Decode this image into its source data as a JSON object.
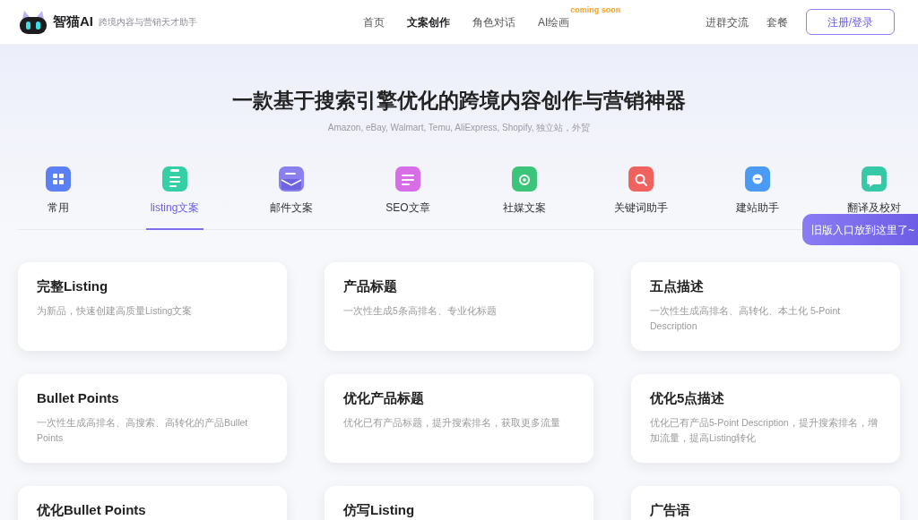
{
  "header": {
    "logo": {
      "name": "智猫AI",
      "tagline": "跨境内容与营销天才助手"
    },
    "nav": [
      {
        "label": "首页",
        "selected": false
      },
      {
        "label": "文案创作",
        "selected": true
      },
      {
        "label": "角色对话",
        "selected": false
      },
      {
        "label": "AI绘画",
        "selected": false,
        "badge": "coming soon"
      }
    ],
    "links": [
      "进群交流",
      "套餐"
    ],
    "login_button": "注册/登录"
  },
  "hero": {
    "title": "一款基于搜索引擎优化的跨境内容创作与营销神器",
    "subtitle": "Amazon, eBay, Walmart, Temu, AliExpress, Shopify, 独立站，外贸"
  },
  "tabs": [
    {
      "label": "常用",
      "selected": false,
      "color": "#5b7ff5"
    },
    {
      "label": "listing文案",
      "selected": true,
      "color": "#35cfa6"
    },
    {
      "label": "邮件文案",
      "selected": false,
      "color": "#8a80f0"
    },
    {
      "label": "SEO文章",
      "selected": false,
      "color": "#d86ee6"
    },
    {
      "label": "社媒文案",
      "selected": false,
      "color": "#3cc57a"
    },
    {
      "label": "关键词助手",
      "selected": false,
      "color": "#f0625e"
    },
    {
      "label": "建站助手",
      "selected": false,
      "color": "#4a9bf5"
    },
    {
      "label": "翻译及校对",
      "selected": false,
      "color": "#36c9a8"
    }
  ],
  "notice": "旧版入口放到这里了~",
  "cards": [
    {
      "title": "完整Listing",
      "description": "为新品，快速创建高质量Listing文案"
    },
    {
      "title": "产品标题",
      "description": "一次性生成5条高排名、专业化标题"
    },
    {
      "title": "五点描述",
      "description": "一次性生成高排名、高转化、本土化 5-Point Description"
    },
    {
      "title": "Bullet Points",
      "description": "一次性生成高排名、高搜索、高转化的产品Bullet Points"
    },
    {
      "title": "优化产品标题",
      "description": "优化已有产品标题，提升搜索排名，获取更多流量"
    },
    {
      "title": "优化5点描述",
      "description": "优化已有产品5-Point Description，提升搜索排名，增加流量，提高Listing转化"
    },
    {
      "title": "优化Bullet Points"
    },
    {
      "title": "仿写Listing"
    },
    {
      "title": "广告语"
    }
  ]
}
